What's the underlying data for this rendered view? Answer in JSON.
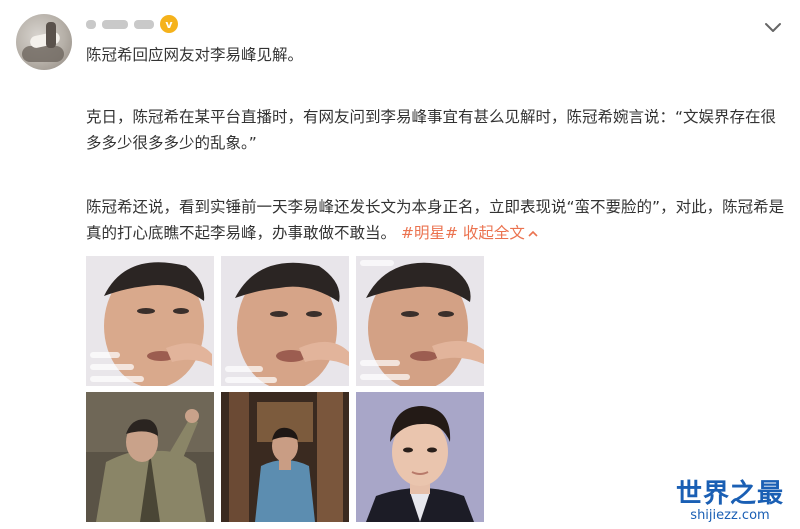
{
  "post": {
    "title_line": "陈冠希回应网友对李易峰见解。",
    "para1": "克日，陈冠希在某平台直播时，有网友问到李易峰事宜有甚么见解时，陈冠希婉言说：“文娱界存在很多多少很多多少的乱象。”",
    "para2_text": "陈冠希还说，看到实锤前一天李易峰还发长文为本身正名，立即表现说“蛮不要脸的”，对此，陈冠希是真的打心底瞧不起李易峰，办事敢做不敢当。",
    "hashtag": "#明星#",
    "collapse_label": "收起全文"
  },
  "icons": {
    "vip_badge": "vip-badge-icon",
    "more": "chevron-down-icon"
  },
  "images": [
    {
      "name": "livestream-screenshot-1"
    },
    {
      "name": "livestream-screenshot-2"
    },
    {
      "name": "livestream-screenshot-3"
    },
    {
      "name": "photo-portrait-green-jacket"
    },
    {
      "name": "photo-portrait-blue-shirt"
    },
    {
      "name": "photo-portrait-dark-suit"
    }
  ],
  "watermark": {
    "title": "世界之最",
    "url": "shijiezz.com"
  },
  "colors": {
    "text": "#333333",
    "link": "#eb7350",
    "watermark": "#1a5fb4"
  }
}
